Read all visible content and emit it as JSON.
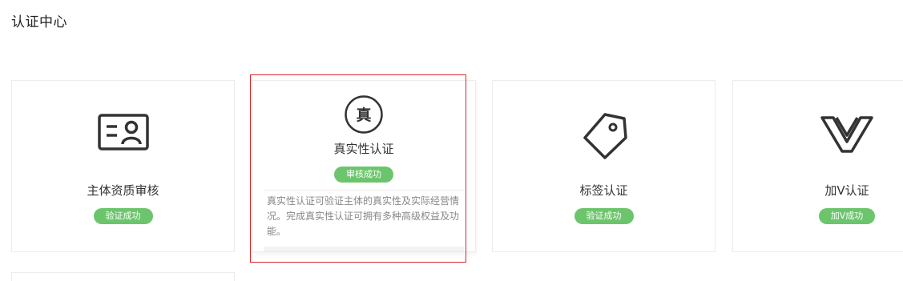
{
  "page": {
    "title": "认证中心"
  },
  "cards": [
    {
      "title": "主体资质审核",
      "icon": "id-card-icon",
      "status": "验证成功"
    },
    {
      "title": "真实性认证",
      "icon": "zhen-seal-icon",
      "icon_char": "真",
      "status": "审核成功",
      "description": "真实性认证可验证主体的真实性及实际经营情况。完成真实性认证可拥有多种高级权益及功能。"
    },
    {
      "title": "标签认证",
      "icon": "tag-icon",
      "status": "验证成功"
    },
    {
      "title": "加V认证",
      "icon": "v-icon",
      "status": "加V成功"
    }
  ],
  "colors": {
    "badge": "#6cc56c",
    "highlight": "#d9262c"
  }
}
